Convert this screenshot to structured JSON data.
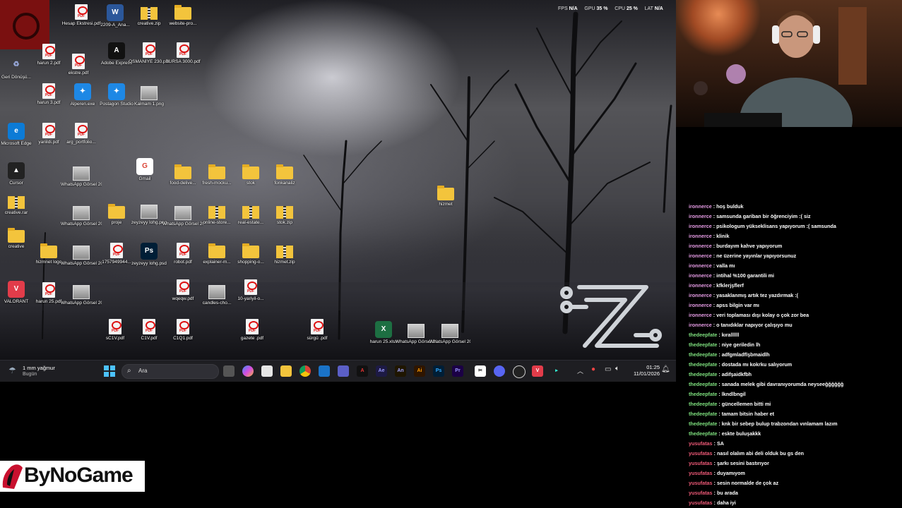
{
  "hud": {
    "fps_label": "FPS",
    "fps_value": "N/A",
    "gpu_label": "GPU",
    "gpu_value": "35 %",
    "cpu_label": "CPU",
    "cpu_value": "25 %",
    "lat_label": "LAT",
    "lat_value": "N/A"
  },
  "desktop_icons": [
    {
      "name": "pdf",
      "label": "Hesap Ekstresi.pdf"
    },
    {
      "name": "word",
      "label": "2209-A_Ana..."
    },
    {
      "name": "zip",
      "label": "creative.zip"
    },
    {
      "name": "folder",
      "label": "website-pro..."
    },
    {
      "name": "pdf",
      "label": "harun 2.pdf"
    },
    {
      "name": "recycle",
      "label": "Geri Dönüşü..."
    },
    {
      "name": "pdf",
      "label": "ekstre.pdf"
    },
    {
      "name": "adobe-express",
      "label": "Adobe Express"
    },
    {
      "name": "pdf",
      "label": "OSMANİYE 230.pdf"
    },
    {
      "name": "pdf",
      "label": "BURSA 3000.pdf"
    },
    {
      "name": "pdf",
      "label": "harun 3.pdf"
    },
    {
      "name": "app",
      "label": "Alperen.exe"
    },
    {
      "name": "app",
      "label": "Postagon Studio"
    },
    {
      "name": "image",
      "label": "Kalmam 1.png"
    },
    {
      "name": "edge",
      "label": "Microsoft Edge"
    },
    {
      "name": "pdf",
      "label": "yariildi.pdf"
    },
    {
      "name": "pdf",
      "label": "arg_portfolio..."
    },
    {
      "name": "cursor",
      "label": "Cursor"
    },
    {
      "name": "image",
      "label": "WhatsApp Görsel 2025..."
    },
    {
      "name": "chrome",
      "label": "Gmail"
    },
    {
      "name": "folder",
      "label": "food-delive..."
    },
    {
      "name": "folder",
      "label": "fresh-mocku..."
    },
    {
      "name": "folder",
      "label": "stok"
    },
    {
      "name": "folder",
      "label": "fonkanaliz"
    },
    {
      "name": "rar",
      "label": "creative.rar"
    },
    {
      "name": "image",
      "label": "WhatsApp Görsel 2025..."
    },
    {
      "name": "folder",
      "label": "proje"
    },
    {
      "name": "image",
      "label": "zeyzeyy lohg.png"
    },
    {
      "name": "image",
      "label": "WhatsApp Görsel 2025..."
    },
    {
      "name": "zip",
      "label": "online-store..."
    },
    {
      "name": "zip",
      "label": "real-estate..."
    },
    {
      "name": "zip",
      "label": "stok.zip"
    },
    {
      "name": "folder",
      "label": "hizmet"
    },
    {
      "name": "folder",
      "label": "creative"
    },
    {
      "name": "folder",
      "label": "hizmnet logo"
    },
    {
      "name": "image",
      "label": "WhatsApp Görsel 202..."
    },
    {
      "name": "pdf",
      "label": "1757949944..."
    },
    {
      "name": "psd",
      "label": "zeyzeyy lohg.psd"
    },
    {
      "name": "pdf",
      "label": "robot.pdf"
    },
    {
      "name": "folder",
      "label": "explainer-m..."
    },
    {
      "name": "folder",
      "label": "shopping-o..."
    },
    {
      "name": "zip",
      "label": "hizmet.zip"
    },
    {
      "name": "valorant",
      "label": "VALORANT"
    },
    {
      "name": "pdf",
      "label": "harun 25.pdf"
    },
    {
      "name": "image",
      "label": "WhatsApp Görsel 2025..."
    },
    {
      "name": "pdf",
      "label": "wqeqw.pdf"
    },
    {
      "name": "image",
      "label": "candles-cho..."
    },
    {
      "name": "pdf",
      "label": "10-yariyil-o..."
    },
    {
      "name": "pdf",
      "label": "sC1V.pdf"
    },
    {
      "name": "pdf",
      "label": "C1V.pdf"
    },
    {
      "name": "pdf",
      "label": "C1Q1.pdf"
    },
    {
      "name": "pdf",
      "label": "gazete .pdf"
    },
    {
      "name": "pdf",
      "label": "sürgü .pdf"
    },
    {
      "name": "excel",
      "label": "harun 25.xlsx"
    },
    {
      "name": "image",
      "label": "WhatsApp Görsel 202..."
    },
    {
      "name": "image",
      "label": "WhatsApp Görsel 202..."
    }
  ],
  "taskbar": {
    "weather_temp": "1 mm yağmur",
    "weather_day": "Bugün",
    "search_placeholder": "Ara",
    "time": "01:25",
    "date": "11/01/2026"
  },
  "chat": [
    {
      "user": "ironnerce",
      "color": "#e59be4",
      "text": "hoş bulduk"
    },
    {
      "user": "ironnerce",
      "color": "#e59be4",
      "text": "samsunda gariban bir öğrenciyim :( siz"
    },
    {
      "user": "ironnerce",
      "color": "#e59be4",
      "text": "psikologum yükseklisans yapıyorum :( samsunda"
    },
    {
      "user": "ironnerce",
      "color": "#e59be4",
      "text": "klinik"
    },
    {
      "user": "ironnerce",
      "color": "#e59be4",
      "text": "burdayım kahve yapıyorum"
    },
    {
      "user": "ironnerce",
      "color": "#e59be4",
      "text": "ne üzerine yayınlar yapıyorsunuz"
    },
    {
      "user": "ironnerce",
      "color": "#e59be4",
      "text": "valla mı"
    },
    {
      "user": "ironnerce",
      "color": "#e59be4",
      "text": "intihal %100 garantili mi"
    },
    {
      "user": "ironnerce",
      "color": "#e59be4",
      "text": "kfklerjşflerf"
    },
    {
      "user": "ironnerce",
      "color": "#e59be4",
      "text": "yasaklanmış artık tez yazdırmak :("
    },
    {
      "user": "ironnerce",
      "color": "#e59be4",
      "text": "apss bilgin var mı"
    },
    {
      "user": "ironnerce",
      "color": "#e59be4",
      "text": "veri toplaması dışı kolay o çok zor bea"
    },
    {
      "user": "ironnerce",
      "color": "#e59be4",
      "text": "o tanıdıklar napıyor çalışıyo mu"
    },
    {
      "user": "thedeepfate",
      "color": "#7ee07e",
      "text": "kırallllll"
    },
    {
      "user": "thedeepfate",
      "color": "#7ee07e",
      "text": "niye geriledin lh"
    },
    {
      "user": "thedeepfate",
      "color": "#7ee07e",
      "text": "adfgmladflşbmaidlh"
    },
    {
      "user": "thedeepfate",
      "color": "#7ee07e",
      "text": "dostada mı kokrku salıyorum"
    },
    {
      "user": "thedeepfate",
      "color": "#7ee07e",
      "text": "adifşaidkfbh"
    },
    {
      "user": "thedeepfate",
      "color": "#7ee07e",
      "text": "sanada melek gibi davranıyorumda neyseeğğğğğğ"
    },
    {
      "user": "thedeepfate",
      "color": "#7ee07e",
      "text": "lkndlbngil"
    },
    {
      "user": "thedeepfate",
      "color": "#7ee07e",
      "text": "güncellemen bitti mi"
    },
    {
      "user": "thedeepfate",
      "color": "#7ee07e",
      "text": "tamam bitsin haber et"
    },
    {
      "user": "thedeepfate",
      "color": "#7ee07e",
      "text": "knk bir sebep bulup trabzondan vınlamam lazım"
    },
    {
      "user": "thedeepfate",
      "color": "#7ee07e",
      "text": "eskte buluşakkk"
    },
    {
      "user": "yusufatas",
      "color": "#f05a78",
      "text": "SA"
    },
    {
      "user": "yusufatas",
      "color": "#f05a78",
      "text": "nasıl olalım abi deli olduk bu gs den"
    },
    {
      "user": "yusufatas",
      "color": "#f05a78",
      "text": "şarkı sesini bastırıyor"
    },
    {
      "user": "yusufatas",
      "color": "#f05a78",
      "text": "duyamıyom"
    },
    {
      "user": "yusufatas",
      "color": "#f05a78",
      "text": "sesin normalde de çok az"
    },
    {
      "user": "yusufatas",
      "color": "#f05a78",
      "text": "bu arada"
    },
    {
      "user": "yusufatas",
      "color": "#f05a78",
      "text": "daha iyi"
    }
  ],
  "chat_separator": " : ",
  "brand": {
    "name": "ByNoGame"
  },
  "colors": {
    "taskbar_bg": "#1e1e22",
    "desktop_fog": "#d9d9de",
    "pdf_red": "#d11111",
    "folder_yellow": "#f3c43c"
  }
}
